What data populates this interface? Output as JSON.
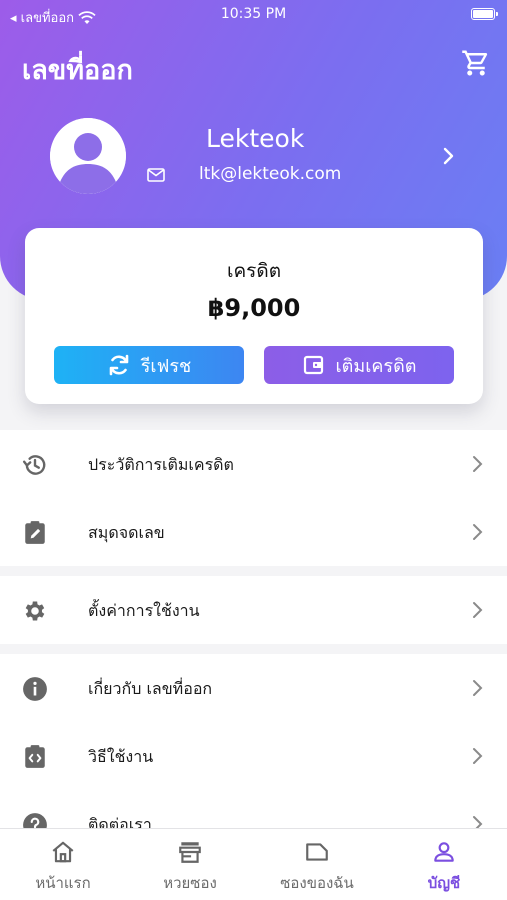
{
  "status_bar": {
    "back_label": "◂ เลขที่ออก",
    "time": "10:35 PM"
  },
  "header": {
    "app_title": "เลขที่ออก"
  },
  "profile": {
    "name": "Lekteok",
    "email": "ltk@lekteok.com"
  },
  "credit": {
    "label": "เครดิต",
    "amount": "฿9,000",
    "refresh_label": "รีเฟรช",
    "topup_label": "เติมเครดิต"
  },
  "menu": {
    "group1": [
      {
        "label": "ประวัติการเติมเครดิต",
        "icon": "history-icon"
      },
      {
        "label": "สมุดจดเลข",
        "icon": "clipboard-edit-icon"
      }
    ],
    "group2": [
      {
        "label": "ตั้งค่าการใช้งาน",
        "icon": "gear-icon"
      }
    ],
    "group3": [
      {
        "label": "เกี่ยวกับ เลขที่ออก",
        "icon": "info-icon"
      },
      {
        "label": "วิธีใช้งาน",
        "icon": "code-clipboard-icon"
      },
      {
        "label": "ติดต่อเรา",
        "icon": "help-icon"
      }
    ]
  },
  "tabbar": [
    {
      "label": "หน้าแรก",
      "icon": "home-icon"
    },
    {
      "label": "หวยซอง",
      "icon": "store-icon"
    },
    {
      "label": "ซองของฉัน",
      "icon": "envelope-icon"
    },
    {
      "label": "บัญชี",
      "icon": "user-icon",
      "active": true
    }
  ],
  "colors": {
    "header_gradient_start": "#9d5ce9",
    "header_gradient_end": "#6a7ff4",
    "refresh_button": "#1eb2f5",
    "topup_button": "#8c5ee7",
    "active_tab": "#7b4fe0"
  }
}
